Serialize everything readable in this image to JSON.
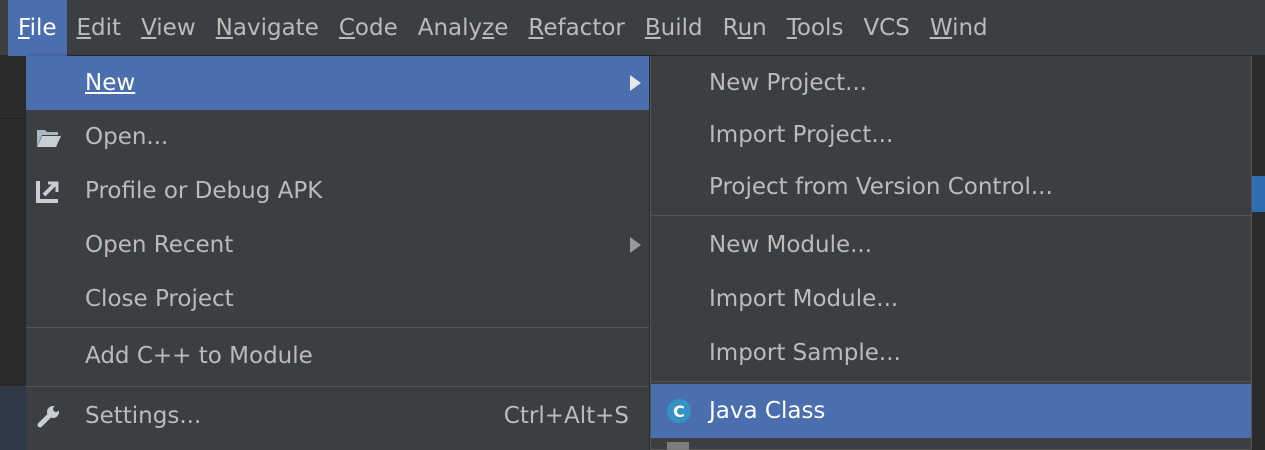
{
  "menubar": {
    "items": [
      {
        "label": "File",
        "mnemonic_index": 0,
        "active": true
      },
      {
        "label": "Edit",
        "mnemonic_index": 0,
        "active": false
      },
      {
        "label": "View",
        "mnemonic_index": 0,
        "active": false
      },
      {
        "label": "Navigate",
        "mnemonic_index": 0,
        "active": false
      },
      {
        "label": "Code",
        "mnemonic_index": 0,
        "active": false
      },
      {
        "label": "Analyze",
        "mnemonic_index": 5,
        "active": false
      },
      {
        "label": "Refactor",
        "mnemonic_index": 0,
        "active": false
      },
      {
        "label": "Build",
        "mnemonic_index": 0,
        "active": false
      },
      {
        "label": "Run",
        "mnemonic_index": 1,
        "active": false
      },
      {
        "label": "Tools",
        "mnemonic_index": 0,
        "active": false
      },
      {
        "label": "VCS",
        "mnemonic_index": -1,
        "active": false
      },
      {
        "label": "Wind",
        "mnemonic_index": 0,
        "active": false
      }
    ]
  },
  "file_menu": {
    "new_label": "New",
    "open_label": "Open...",
    "profile_label": "Profile or Debug APK",
    "open_recent_label": "Open Recent",
    "close_project_label": "Close Project",
    "add_cpp_label": "Add C++ to Module",
    "settings_label": "Settings...",
    "settings_shortcut": "Ctrl+Alt+S"
  },
  "new_submenu": {
    "items": [
      "New Project...",
      "Import Project...",
      "Project from Version Control...",
      "New Module...",
      "Import Module...",
      "Import Sample...",
      "Java Class"
    ]
  },
  "icons": {
    "open": "folder-icon",
    "profile": "profile-debug-icon",
    "settings": "wrench-icon",
    "java_class": "java-class-icon",
    "java_class_letter": "C",
    "submenu_arrow": "chevron-right-icon"
  },
  "colors": {
    "menu_bg": "#3c3f41",
    "highlight": "#4b6eaf",
    "text": "#bbbbbb",
    "java_icon": "#3592c4"
  }
}
